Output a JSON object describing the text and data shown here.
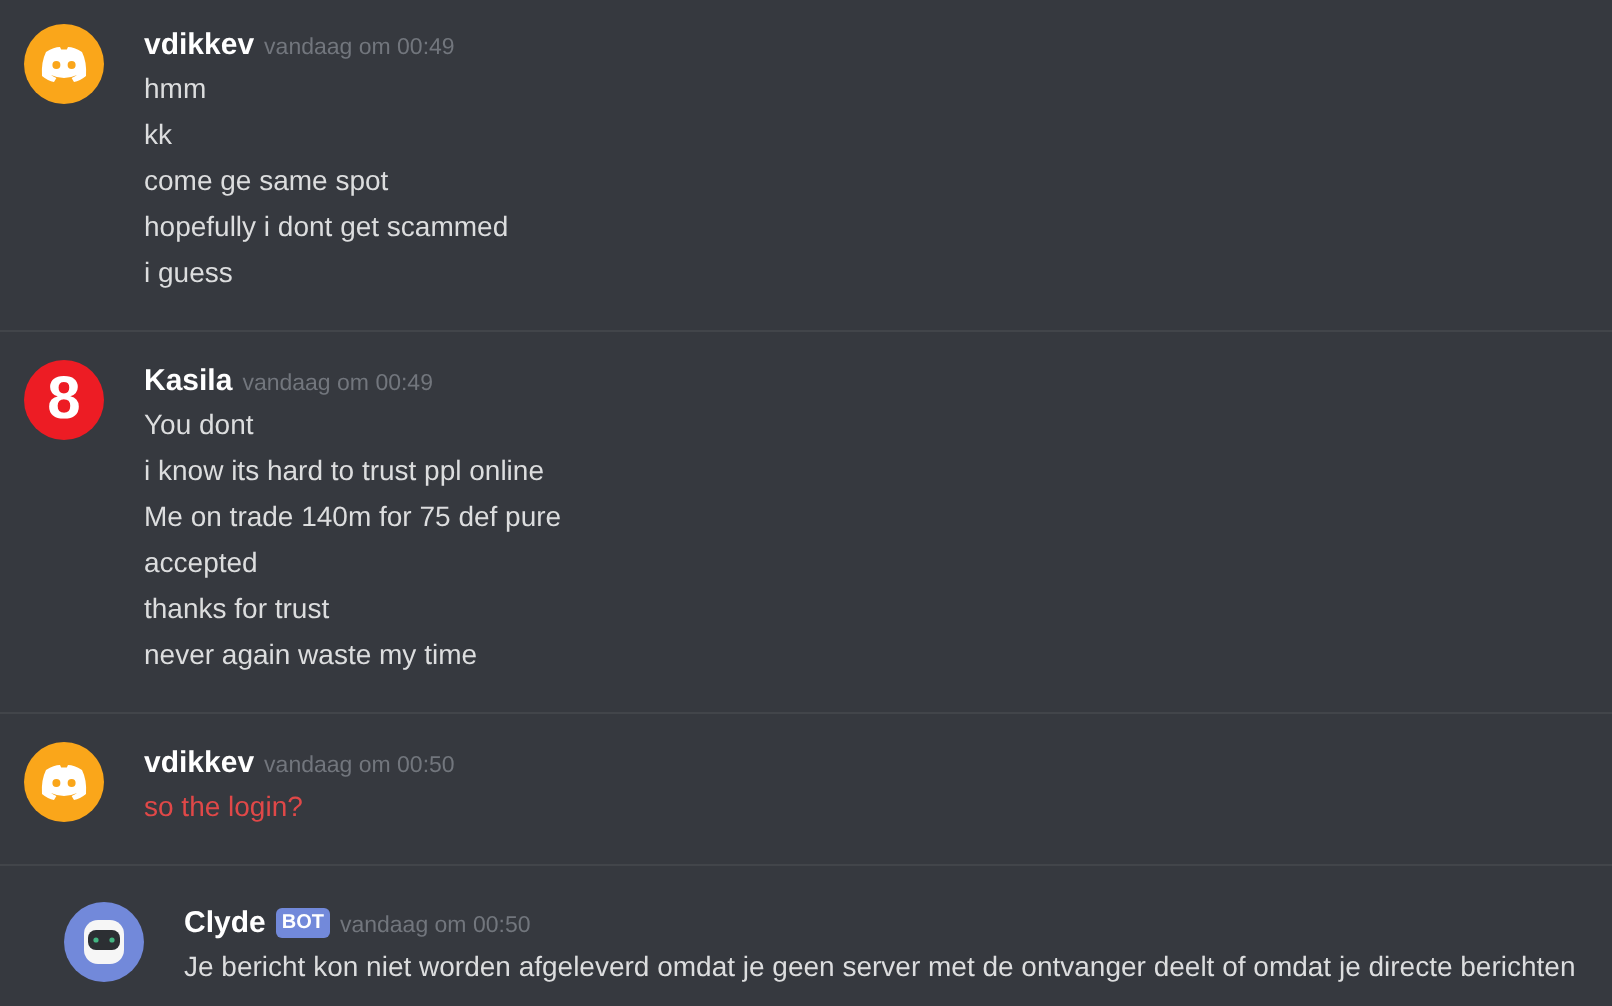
{
  "messages": [
    {
      "author": "vdikkev",
      "timestamp": "vandaag om 00:49",
      "avatar": {
        "kind": "logo",
        "color": "#faa61a"
      },
      "failed": false,
      "lines": [
        "hmm",
        "kk",
        "come ge same spot",
        "hopefully i dont get scammed",
        "i guess"
      ]
    },
    {
      "author": "Kasila",
      "timestamp": "vandaag om 00:49",
      "avatar": {
        "kind": "number",
        "color": "#ed1c24",
        "text": "8"
      },
      "failed": false,
      "lines": [
        "You dont",
        "i know its hard to trust ppl online",
        "Me on trade 140m for 75 def pure",
        "accepted",
        "thanks for trust",
        "never again waste my time"
      ]
    },
    {
      "author": "vdikkev",
      "timestamp": "vandaag om 00:50",
      "avatar": {
        "kind": "logo",
        "color": "#faa61a"
      },
      "failed": true,
      "lines": [
        "so the login?"
      ]
    },
    {
      "author": "Clyde",
      "badge": "BOT",
      "timestamp": "vandaag om 00:50",
      "avatar": {
        "kind": "robot",
        "color": "#7289da"
      },
      "failed": false,
      "lines": [
        "Je bericht kon niet worden afgeleverd omdat je geen server met de ontvanger deelt of omdat je directe berichten"
      ]
    }
  ]
}
